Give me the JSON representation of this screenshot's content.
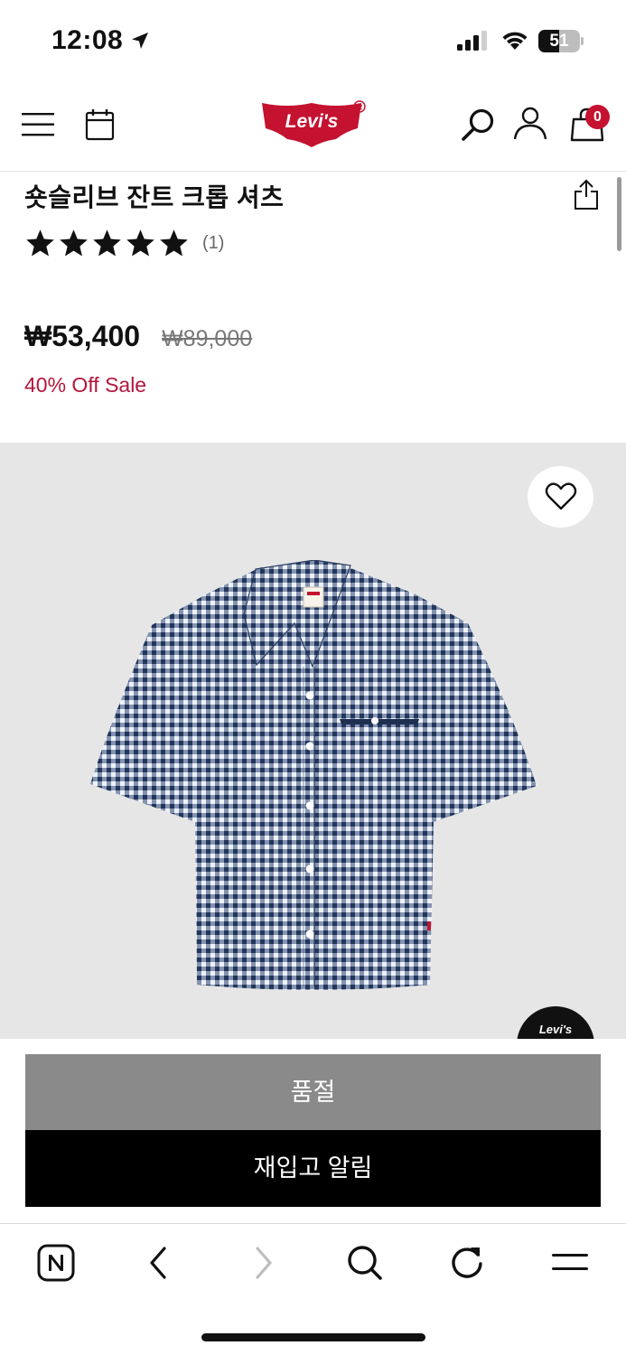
{
  "status_bar": {
    "time": "12:08",
    "battery_level": "51",
    "battery_fraction": 0.51
  },
  "header": {
    "brand": "Levi's",
    "brand_mark": "®",
    "cart_count": "0",
    "icons": [
      "menu-icon",
      "calendar-icon",
      "search-icon",
      "account-icon",
      "shopping-bag-icon"
    ]
  },
  "product": {
    "title": "숏슬리브 잔트 크롭 셔츠",
    "rating": 5,
    "rating_max": 5,
    "review_count": "(1)",
    "price_current": "₩53,400",
    "price_original": "₩89,000",
    "sale_label": "40% Off Sale",
    "image_label": "Levi's"
  },
  "actions": {
    "sold_out": "품절",
    "notify_restock": "재입고 알림"
  },
  "browser_toolbar": {
    "icons": [
      "naver-home-icon",
      "back-icon",
      "forward-icon",
      "search-icon",
      "refresh-icon",
      "menu-icon"
    ]
  },
  "colors": {
    "brand_red": "#c41230",
    "sale_red": "#b3163a",
    "soldout_gray": "#8a8a8a",
    "image_bg": "#e6e6e6"
  }
}
